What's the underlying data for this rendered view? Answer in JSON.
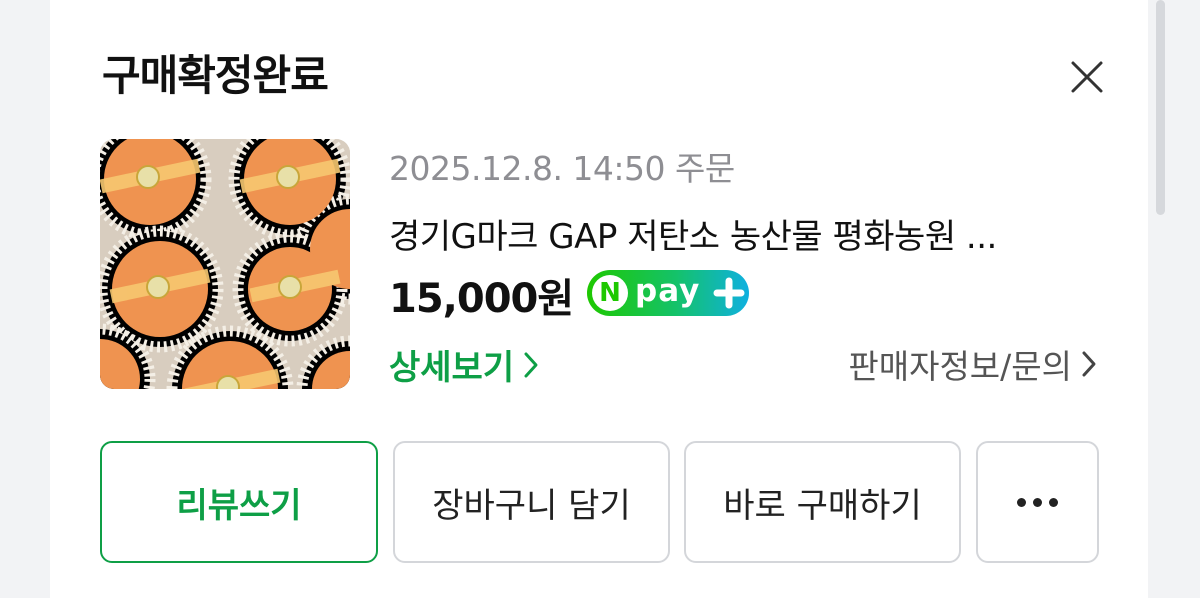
{
  "modal": {
    "title": "구매확정완료"
  },
  "order": {
    "date": "2025.12.8. 14:50 주문",
    "product_name": "경기G마크 GAP 저탄소 농산물 평화농원 ...",
    "price": "15,000원",
    "npay_n": "N",
    "npay_label": "pay",
    "detail_link": "상세보기",
    "seller_link": "판매자정보/문의"
  },
  "actions": {
    "review": "리뷰쓰기",
    "cart": "장바구니 담기",
    "buy_now": "바로 구매하기"
  },
  "colors": {
    "accent_green": "#0e9f46",
    "npay_green": "#1ec800",
    "npay_blue": "#0fb0e0",
    "background": "#f2f3f5"
  }
}
